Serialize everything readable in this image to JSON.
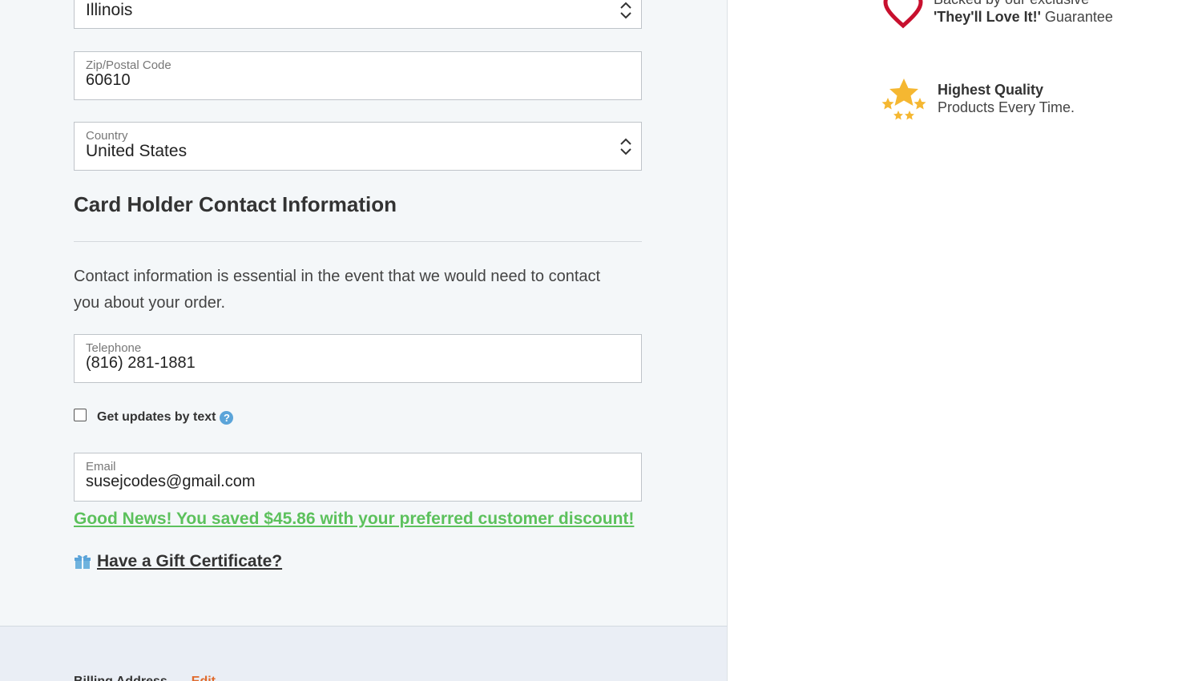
{
  "address": {
    "state": {
      "value": "Illinois"
    },
    "zip": {
      "label": "Zip/Postal Code",
      "value": "60610"
    },
    "country": {
      "label": "Country",
      "value": "United States"
    }
  },
  "contact": {
    "title": "Card Holder Contact Information",
    "description": "Contact information is essential in the event that we would need to contact you about your order.",
    "telephone": {
      "label": "Telephone",
      "value": "(816) 281-1881"
    },
    "sms": {
      "label": "Get updates by text",
      "help": "?"
    },
    "email": {
      "label": "Email",
      "value": "susejcodes@gmail.com"
    }
  },
  "discount_message": "Good News! You saved $45.86 with your preferred customer discount!",
  "gift_link": "Have a Gift Certificate?",
  "billing": {
    "label": "Billing Address",
    "edit": "Edit"
  },
  "badges": {
    "guarantee": {
      "line1": "Backed by our exclusive",
      "bold": "'They'll Love It!'",
      "rest": " Guarantee"
    },
    "quality": {
      "bold": "Highest Quality",
      "line2": "Products Every Time."
    }
  },
  "colors": {
    "accent_green": "#5cc15c",
    "heart_red": "#c8102e",
    "star_gold": "#f5b731",
    "help_blue": "#5ba4d9",
    "edit_orange": "#e06a2c"
  }
}
